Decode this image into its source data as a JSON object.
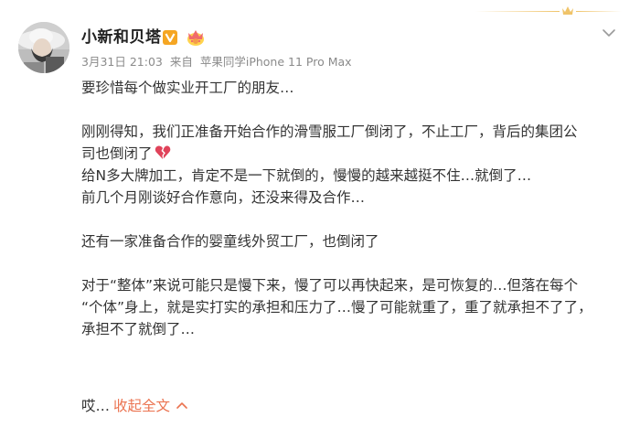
{
  "post": {
    "author": {
      "name": "小新和贝塔",
      "verified_badge": "v-verified-icon",
      "member_badge": "crown-member-icon"
    },
    "meta": {
      "date": "3月31日 21:03",
      "source_prefix": "来自",
      "source": "苹果同学iPhone 11 Pro Max"
    },
    "content": {
      "line1": "要珍惜每个做实业开工厂的朋友…",
      "line2": "刚刚得知，我们正准备开始合作的滑雪服工厂倒闭了，不止工厂，背后的集团公",
      "line3": "司也倒闭了",
      "line3_emoji": "broken-heart-icon",
      "line4": "给N多大牌加工，肯定不是一下就倒的，慢慢的越来越挺不住…就倒了…",
      "line5": "前几个月刚谈好合作意向，还没来得及合作…",
      "line6": "还有一家准备合作的婴童线外贸工厂，也倒闭了",
      "line7": "对于“整体”来说可能只是慢下来，慢了可以再快起来，是可恢复的…但落在每个",
      "line8": "“个体”身上，就是实打实的承担和压力了…慢了可能就重了，重了就承担不了了，",
      "line9": "承担不了就倒了…"
    },
    "footer": {
      "ellipsis_text": "哎…",
      "collapse_label": "收起全文",
      "collapse_icon": "chevron-up-icon"
    }
  },
  "colors": {
    "text": "#333333",
    "meta": "#8a8a8a",
    "link": "#eb7350",
    "badge_orange": "#f5a623",
    "deco_gold": "#f0c46a"
  }
}
